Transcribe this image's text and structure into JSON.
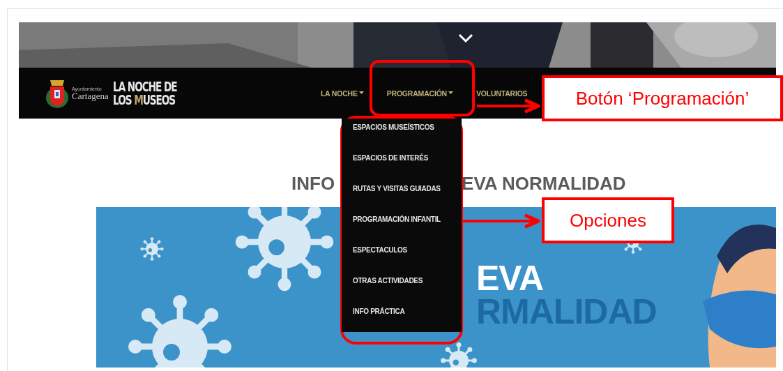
{
  "hero": {
    "kind": "picture"
  },
  "header": {
    "logo": {
      "line1": "Ayuntamiento",
      "line2": "Cartagena"
    },
    "site_title": {
      "line1": "LA NOCHE DE",
      "line2_start": "LOS ",
      "highlight": "M",
      "line2_end": "USEOS"
    }
  },
  "nav": [
    {
      "label": "LA NOCHE",
      "dropdown": true
    },
    {
      "label": "PROGRAMACIÓN",
      "dropdown": true
    },
    {
      "label": "VOLUNTARIOS",
      "dropdown": false
    }
  ],
  "dropdown_menu": [
    "ESPACIOS MUSEÍSTICOS",
    "ESPACIOS DE INTERÉS",
    "RUTAS Y VISITAS GUIADAS",
    "PROGRAMACIÓN INFANTIL",
    "ESPECTACULOS",
    "OTRAS ACTIVIDADES",
    "INFO PRÁCTICA"
  ],
  "heading_parts": [
    "INFO",
    "EVA NORMALIDAD"
  ],
  "banner": {
    "line1": "EVA",
    "line2": "RMALIDAD"
  },
  "annotations": [
    {
      "kind": "button_callout",
      "label": "Botón ‘Programación’"
    },
    {
      "kind": "menu_callout",
      "label": "Opciones"
    }
  ]
}
